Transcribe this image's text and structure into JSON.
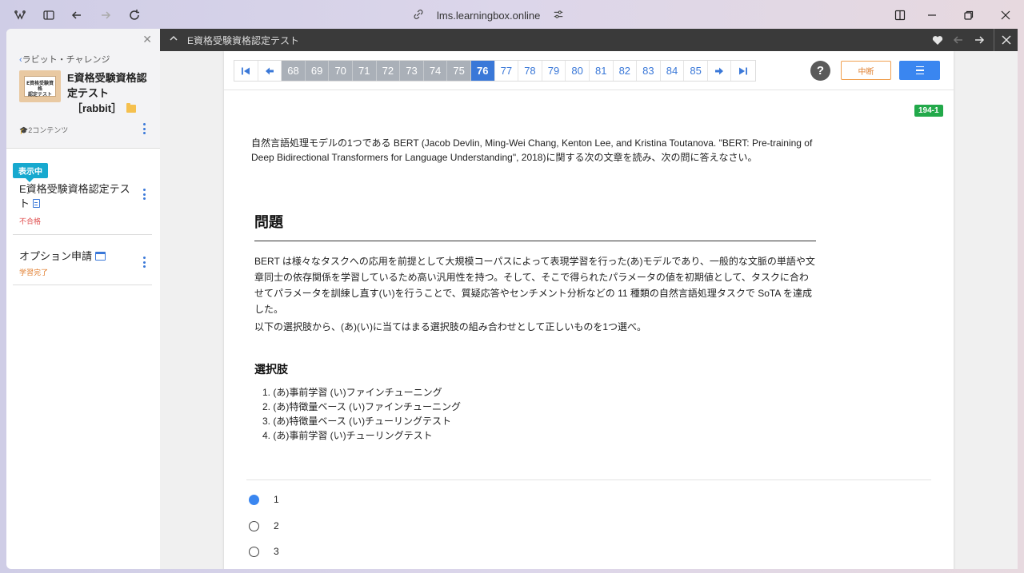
{
  "browser": {
    "url": "lms.learningbox.online"
  },
  "sidebar": {
    "back_label": "ラビット・チャレンジ",
    "thumb_line1": "E資格受験資格",
    "thumb_line2": "認定テスト",
    "course_title": "E資格受験資格認定テスト",
    "course_tag": "［rabbit］",
    "content_count": "2コンテンツ",
    "items": [
      {
        "badge": "表示中",
        "title": "E資格受験資格認定テスト",
        "status": "不合格"
      },
      {
        "title": "オプション申請",
        "status": "学習完了"
      }
    ]
  },
  "topbar": {
    "title": "E資格受験資格認定テスト"
  },
  "pager": {
    "pages": [
      "68",
      "69",
      "70",
      "71",
      "72",
      "73",
      "74",
      "75",
      "76",
      "77",
      "78",
      "79",
      "80",
      "81",
      "82",
      "83",
      "84",
      "85"
    ],
    "current": "76",
    "visited": [
      "68",
      "69",
      "70",
      "71",
      "72",
      "73",
      "74",
      "75"
    ]
  },
  "controls": {
    "help": "?",
    "pause": "中断"
  },
  "question": {
    "id": "194-1",
    "intro": "自然言語処理モデルの1つである BERT (Jacob Devlin, Ming-Wei Chang, Kenton Lee, and Kristina Toutanova. \"BERT: Pre-training of Deep Bidirectional Transformers for Language Understanding\", 2018)に関する次の文章を読み、次の問に答えなさい。",
    "heading": "問題",
    "paragraph": "BERT は様々なタスクへの応用を前提として大規模コーパスによって表現学習を行った(あ)モデルであり、一般的な文脈の単語や文章同士の依存関係を学習しているため高い汎用性を持つ。そして、そこで得られたパラメータの値を初期値として、タスクに合わせてパラメータを訓練し直す(い)を行うことで、質疑応答やセンチメント分析などの 11 種類の自然言語処理タスクで SoTA を達成した。",
    "instruction": "以下の選択肢から、(あ)(い)に当てはまる選択肢の組み合わせとして正しいものを1つ選べ。",
    "choices_heading": "選択肢",
    "choices": [
      "1. (あ)事前学習 (い)ファインチューニング",
      "2. (あ)特徴量ベース (い)ファインチューニング",
      "3. (あ)特徴量ベース (い)チューリングテスト",
      "4. (あ)事前学習 (い)チューリングテスト"
    ],
    "answers": [
      "1",
      "2",
      "3"
    ],
    "selected": "1"
  },
  "colors": {
    "accent": "#3a78d8",
    "visited_page": "#aab0b8",
    "badge": "#17a9cf",
    "qid": "#22a94a",
    "pause": "#e08030",
    "fail": "#e05050",
    "done": "#e07b2a"
  }
}
